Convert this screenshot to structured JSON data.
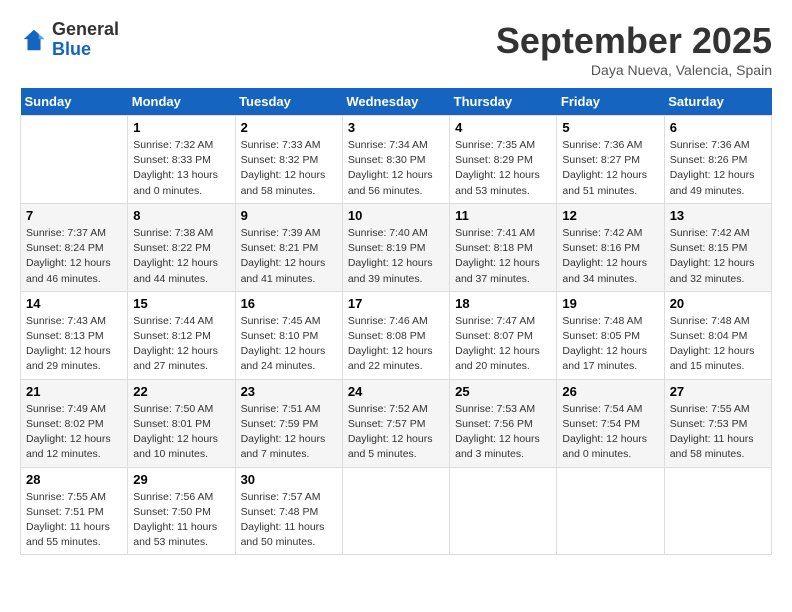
{
  "header": {
    "logo_general": "General",
    "logo_blue": "Blue",
    "month_title": "September 2025",
    "location": "Daya Nueva, Valencia, Spain"
  },
  "days_of_week": [
    "Sunday",
    "Monday",
    "Tuesday",
    "Wednesday",
    "Thursday",
    "Friday",
    "Saturday"
  ],
  "weeks": [
    [
      {
        "num": "",
        "sunrise": "",
        "sunset": "",
        "daylight": "",
        "empty": true
      },
      {
        "num": "1",
        "sunrise": "Sunrise: 7:32 AM",
        "sunset": "Sunset: 8:33 PM",
        "daylight": "Daylight: 13 hours and 0 minutes."
      },
      {
        "num": "2",
        "sunrise": "Sunrise: 7:33 AM",
        "sunset": "Sunset: 8:32 PM",
        "daylight": "Daylight: 12 hours and 58 minutes."
      },
      {
        "num": "3",
        "sunrise": "Sunrise: 7:34 AM",
        "sunset": "Sunset: 8:30 PM",
        "daylight": "Daylight: 12 hours and 56 minutes."
      },
      {
        "num": "4",
        "sunrise": "Sunrise: 7:35 AM",
        "sunset": "Sunset: 8:29 PM",
        "daylight": "Daylight: 12 hours and 53 minutes."
      },
      {
        "num": "5",
        "sunrise": "Sunrise: 7:36 AM",
        "sunset": "Sunset: 8:27 PM",
        "daylight": "Daylight: 12 hours and 51 minutes."
      },
      {
        "num": "6",
        "sunrise": "Sunrise: 7:36 AM",
        "sunset": "Sunset: 8:26 PM",
        "daylight": "Daylight: 12 hours and 49 minutes."
      }
    ],
    [
      {
        "num": "7",
        "sunrise": "Sunrise: 7:37 AM",
        "sunset": "Sunset: 8:24 PM",
        "daylight": "Daylight: 12 hours and 46 minutes."
      },
      {
        "num": "8",
        "sunrise": "Sunrise: 7:38 AM",
        "sunset": "Sunset: 8:22 PM",
        "daylight": "Daylight: 12 hours and 44 minutes."
      },
      {
        "num": "9",
        "sunrise": "Sunrise: 7:39 AM",
        "sunset": "Sunset: 8:21 PM",
        "daylight": "Daylight: 12 hours and 41 minutes."
      },
      {
        "num": "10",
        "sunrise": "Sunrise: 7:40 AM",
        "sunset": "Sunset: 8:19 PM",
        "daylight": "Daylight: 12 hours and 39 minutes."
      },
      {
        "num": "11",
        "sunrise": "Sunrise: 7:41 AM",
        "sunset": "Sunset: 8:18 PM",
        "daylight": "Daylight: 12 hours and 37 minutes."
      },
      {
        "num": "12",
        "sunrise": "Sunrise: 7:42 AM",
        "sunset": "Sunset: 8:16 PM",
        "daylight": "Daylight: 12 hours and 34 minutes."
      },
      {
        "num": "13",
        "sunrise": "Sunrise: 7:42 AM",
        "sunset": "Sunset: 8:15 PM",
        "daylight": "Daylight: 12 hours and 32 minutes."
      }
    ],
    [
      {
        "num": "14",
        "sunrise": "Sunrise: 7:43 AM",
        "sunset": "Sunset: 8:13 PM",
        "daylight": "Daylight: 12 hours and 29 minutes."
      },
      {
        "num": "15",
        "sunrise": "Sunrise: 7:44 AM",
        "sunset": "Sunset: 8:12 PM",
        "daylight": "Daylight: 12 hours and 27 minutes."
      },
      {
        "num": "16",
        "sunrise": "Sunrise: 7:45 AM",
        "sunset": "Sunset: 8:10 PM",
        "daylight": "Daylight: 12 hours and 24 minutes."
      },
      {
        "num": "17",
        "sunrise": "Sunrise: 7:46 AM",
        "sunset": "Sunset: 8:08 PM",
        "daylight": "Daylight: 12 hours and 22 minutes."
      },
      {
        "num": "18",
        "sunrise": "Sunrise: 7:47 AM",
        "sunset": "Sunset: 8:07 PM",
        "daylight": "Daylight: 12 hours and 20 minutes."
      },
      {
        "num": "19",
        "sunrise": "Sunrise: 7:48 AM",
        "sunset": "Sunset: 8:05 PM",
        "daylight": "Daylight: 12 hours and 17 minutes."
      },
      {
        "num": "20",
        "sunrise": "Sunrise: 7:48 AM",
        "sunset": "Sunset: 8:04 PM",
        "daylight": "Daylight: 12 hours and 15 minutes."
      }
    ],
    [
      {
        "num": "21",
        "sunrise": "Sunrise: 7:49 AM",
        "sunset": "Sunset: 8:02 PM",
        "daylight": "Daylight: 12 hours and 12 minutes."
      },
      {
        "num": "22",
        "sunrise": "Sunrise: 7:50 AM",
        "sunset": "Sunset: 8:01 PM",
        "daylight": "Daylight: 12 hours and 10 minutes."
      },
      {
        "num": "23",
        "sunrise": "Sunrise: 7:51 AM",
        "sunset": "Sunset: 7:59 PM",
        "daylight": "Daylight: 12 hours and 7 minutes."
      },
      {
        "num": "24",
        "sunrise": "Sunrise: 7:52 AM",
        "sunset": "Sunset: 7:57 PM",
        "daylight": "Daylight: 12 hours and 5 minutes."
      },
      {
        "num": "25",
        "sunrise": "Sunrise: 7:53 AM",
        "sunset": "Sunset: 7:56 PM",
        "daylight": "Daylight: 12 hours and 3 minutes."
      },
      {
        "num": "26",
        "sunrise": "Sunrise: 7:54 AM",
        "sunset": "Sunset: 7:54 PM",
        "daylight": "Daylight: 12 hours and 0 minutes."
      },
      {
        "num": "27",
        "sunrise": "Sunrise: 7:55 AM",
        "sunset": "Sunset: 7:53 PM",
        "daylight": "Daylight: 11 hours and 58 minutes."
      }
    ],
    [
      {
        "num": "28",
        "sunrise": "Sunrise: 7:55 AM",
        "sunset": "Sunset: 7:51 PM",
        "daylight": "Daylight: 11 hours and 55 minutes."
      },
      {
        "num": "29",
        "sunrise": "Sunrise: 7:56 AM",
        "sunset": "Sunset: 7:50 PM",
        "daylight": "Daylight: 11 hours and 53 minutes."
      },
      {
        "num": "30",
        "sunrise": "Sunrise: 7:57 AM",
        "sunset": "Sunset: 7:48 PM",
        "daylight": "Daylight: 11 hours and 50 minutes."
      },
      {
        "num": "",
        "sunrise": "",
        "sunset": "",
        "daylight": "",
        "empty": true
      },
      {
        "num": "",
        "sunrise": "",
        "sunset": "",
        "daylight": "",
        "empty": true
      },
      {
        "num": "",
        "sunrise": "",
        "sunset": "",
        "daylight": "",
        "empty": true
      },
      {
        "num": "",
        "sunrise": "",
        "sunset": "",
        "daylight": "",
        "empty": true
      }
    ]
  ]
}
